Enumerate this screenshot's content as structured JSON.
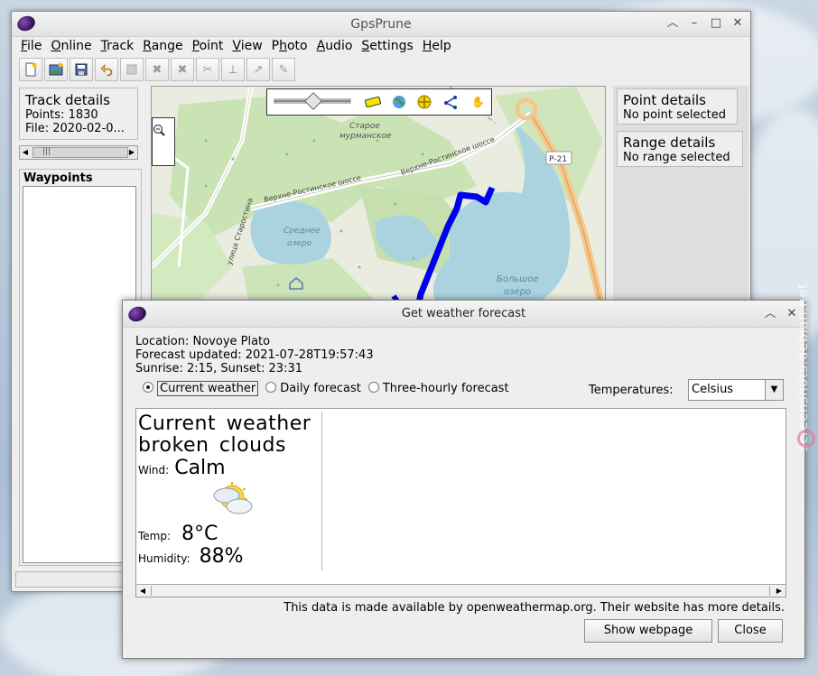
{
  "main_window": {
    "title": "GpsPrune",
    "menu": [
      {
        "key": "F",
        "rest": "ile"
      },
      {
        "key": "O",
        "rest": "nline"
      },
      {
        "key": "T",
        "rest": "rack"
      },
      {
        "key": "R",
        "rest": "ange"
      },
      {
        "key": "P",
        "rest": "oint"
      },
      {
        "key": "V",
        "rest": "iew"
      },
      {
        "key": "Ph",
        "rest": "oto",
        "split": "P",
        "after": "h"
      },
      {
        "key": "A",
        "rest": "udio"
      },
      {
        "key": "S",
        "rest": "ettings"
      },
      {
        "key": "H",
        "rest": "elp"
      }
    ],
    "menu_labels": [
      "File",
      "Online",
      "Track",
      "Range",
      "Point",
      "View",
      "Photo",
      "Audio",
      "Settings",
      "Help"
    ],
    "toolbar": [
      "new-file-icon",
      "load-photo-icon",
      "save-icon",
      "undo-icon",
      "edit-point-icon",
      "delete-point-icon",
      "delete-range-icon",
      "crop-icon",
      "add-point-icon",
      "connect-icon",
      "edit-icon"
    ],
    "track_details": {
      "heading": "Track details",
      "points": "Points: 1830",
      "file": "File: 2020-02-0..."
    },
    "waypoints_heading": "Waypoints",
    "point_details": {
      "heading": "Point details",
      "status": "No point selected"
    },
    "range_details": {
      "heading": "Range details",
      "status": "No range selected"
    },
    "map": {
      "labels": {
        "staroye": "Старое",
        "murmanskoe": "мурманское",
        "road1": "Верхне-Ростинское шоссе",
        "road2": "Верхне-Ростинское шоссе",
        "srednee": "Среднее",
        "ozero1": "озеро",
        "bolshoe": "Большое",
        "ozero2": "озеро",
        "street": "улица Старостина",
        "p21": "Р-21"
      },
      "track_color": "#0000ee"
    }
  },
  "dialog": {
    "title": "Get weather forecast",
    "location": "Location: Novoye Plato",
    "updated": "Forecast updated: 2021-07-28T19:57:43",
    "sun": "Sunrise: 2:15, Sunset: 23:31",
    "radios": [
      {
        "label": "Current weather",
        "selected": true
      },
      {
        "label": "Daily forecast",
        "selected": false
      },
      {
        "label": "Three-hourly forecast",
        "selected": false
      }
    ],
    "temperatures_label": "Temperatures:",
    "temperatures_value": "Celsius",
    "current": {
      "heading": "Current weather",
      "description": "broken clouds",
      "wind_label": "Wind:",
      "wind_value": "Calm",
      "temp_label": "Temp:",
      "temp_value": "8°C",
      "humidity_label": "Humidity:",
      "humidity_value": "88%"
    },
    "credits": "This data is made available by openweathermap.org. Their website has more details.",
    "show_webpage": "Show webpage",
    "close": "Close"
  },
  "watermark": "screenshots.debian.net"
}
